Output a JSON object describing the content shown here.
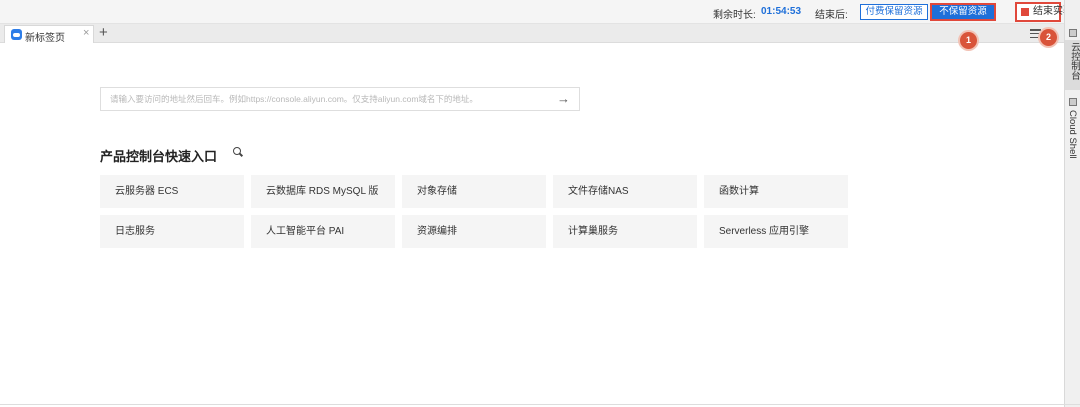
{
  "topbar": {
    "remaining_label": "剩余时长:",
    "remaining_time": "01:54:53",
    "end_after_label": "结束后:",
    "paid_keep_label": "付费保留资源",
    "no_keep_label": "不保留资源",
    "end_experiment_label": "结束实验"
  },
  "tabs": {
    "active_title": "新标签页",
    "close_glyph": "×",
    "new_tab_glyph": "+"
  },
  "markers": [
    "1",
    "2"
  ],
  "sidebar": {
    "console_label": "云控制台",
    "cloud_shell_label": "Cloud Shell"
  },
  "url": {
    "placeholder": "请输入要访问的地址然后回车。例如https://console.aliyun.com。仅支持aliyun.com域名下的地址。",
    "go_glyph": "→"
  },
  "quick_entry": {
    "title": "产品控制台快速入口",
    "items": [
      "云服务器 ECS",
      "云数据库 RDS MySQL 版",
      "对象存储",
      "文件存储NAS",
      "函数计算",
      "日志服务",
      "人工智能平台 PAI",
      "资源编排",
      "计算巢服务",
      "Serverless 应用引擎"
    ]
  },
  "colors": {
    "accent_blue": "#1e6fd9",
    "highlight_red": "#e0483b",
    "marker_orange": "#d9543a"
  },
  "icons": {
    "tab": "cloud-icon",
    "menu": "hamburger-menu-icon",
    "search": "search-icon",
    "go": "arrow-right-icon",
    "stop": "stop-square-icon"
  }
}
